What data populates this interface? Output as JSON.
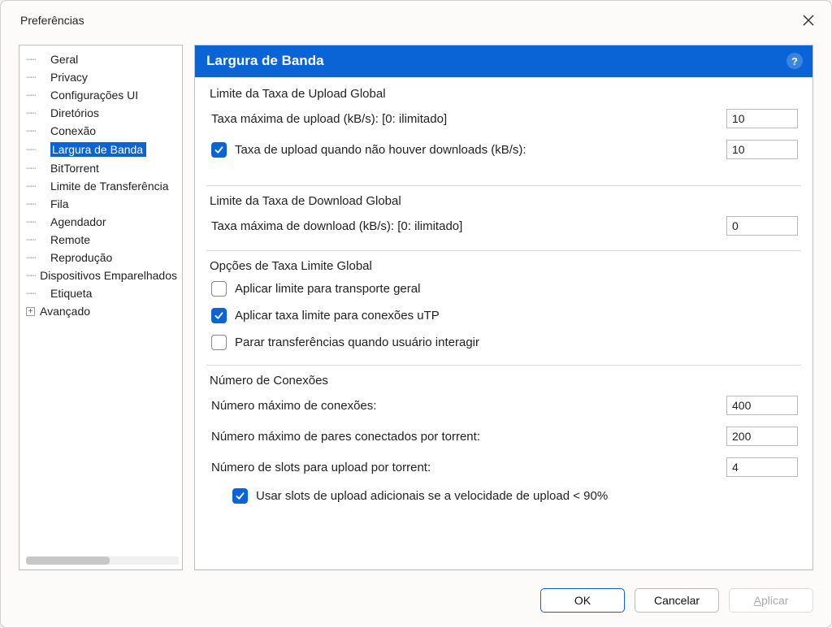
{
  "titlebar": {
    "title": "Preferências"
  },
  "sidebar": {
    "items": [
      {
        "label": "Geral",
        "selected": false
      },
      {
        "label": "Privacy",
        "selected": false
      },
      {
        "label": "Configurações UI",
        "selected": false
      },
      {
        "label": "Diretórios",
        "selected": false
      },
      {
        "label": "Conexão",
        "selected": false
      },
      {
        "label": "Largura de Banda",
        "selected": true
      },
      {
        "label": "BitTorrent",
        "selected": false
      },
      {
        "label": "Limite de Transferência",
        "selected": false
      },
      {
        "label": "Fila",
        "selected": false
      },
      {
        "label": "Agendador",
        "selected": false
      },
      {
        "label": "Remote",
        "selected": false
      },
      {
        "label": "Reprodução",
        "selected": false
      },
      {
        "label": "Dispositivos Emparelhados",
        "selected": false
      },
      {
        "label": "Etiqueta",
        "selected": false
      },
      {
        "label": "Avançado",
        "selected": false,
        "expandable": true
      }
    ]
  },
  "panel": {
    "title": "Largura de Banda"
  },
  "upload": {
    "group_title": "Limite da Taxa de Upload Global",
    "max_rate_label": "Taxa máxima de upload (kB/s): [0: ilimitado]",
    "max_rate_value": "10",
    "alt_rate_check_label": "Taxa de upload quando não houver downloads (kB/s):",
    "alt_rate_checked": true,
    "alt_rate_value": "10"
  },
  "download": {
    "group_title": "Limite da Taxa de Download Global",
    "max_rate_label": "Taxa máxima de download (kB/s): [0: ilimitado]",
    "max_rate_value": "0"
  },
  "options": {
    "group_title": "Opções de Taxa Limite Global",
    "apply_transport_label": "Aplicar limite para transporte geral",
    "apply_transport_checked": false,
    "apply_utp_label": "Aplicar taxa limite para conexões uTP",
    "apply_utp_checked": true,
    "stop_on_interact_label": "Parar transferências quando usuário interagir",
    "stop_on_interact_checked": false
  },
  "connections": {
    "group_title": "Número de Conexões",
    "max_conn_label": "Número máximo de conexões:",
    "max_conn_value": "400",
    "max_peers_label": "Número máximo de pares conectados por torrent:",
    "max_peers_value": "200",
    "upload_slots_label": "Número de slots para upload por torrent:",
    "upload_slots_value": "4",
    "extra_slots_label": "Usar slots de upload adicionais se a velocidade de upload < 90%",
    "extra_slots_checked": true
  },
  "footer": {
    "ok_label": "OK",
    "cancel_label": "Cancelar",
    "apply_label": "Aplicar"
  }
}
